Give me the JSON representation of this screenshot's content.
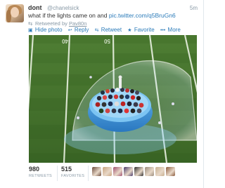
{
  "tweet": {
    "display_name": "dont",
    "handle": "@chanelsick",
    "time": "5m",
    "text": "what if the lights came on and ",
    "link": "pic.twitter.com/q5BruGn6",
    "retweeted_by_label": "Retweeted by ",
    "retweeted_by_user": "Pav80n",
    "actions": {
      "hide_photo": "Hide photo",
      "reply": "Reply",
      "retweet": "Retweet",
      "favorite": "Favorite",
      "more": "More"
    },
    "stats": {
      "retweets_count": "980",
      "retweets_label": "RETWEETS",
      "favorites_count": "515",
      "favorites_label": "FAVORITES"
    },
    "favoriter_avatar_colors": [
      "#6b4a3a",
      "#c9a47e",
      "#a05070",
      "#4a3b6b",
      "#2e2e2e",
      "#9a8c7c",
      "#c8b090",
      "#8a5a3a"
    ]
  },
  "colors": {
    "link": "#2b7bb9",
    "muted": "#8899a6",
    "field_green": "#4a7a30"
  }
}
